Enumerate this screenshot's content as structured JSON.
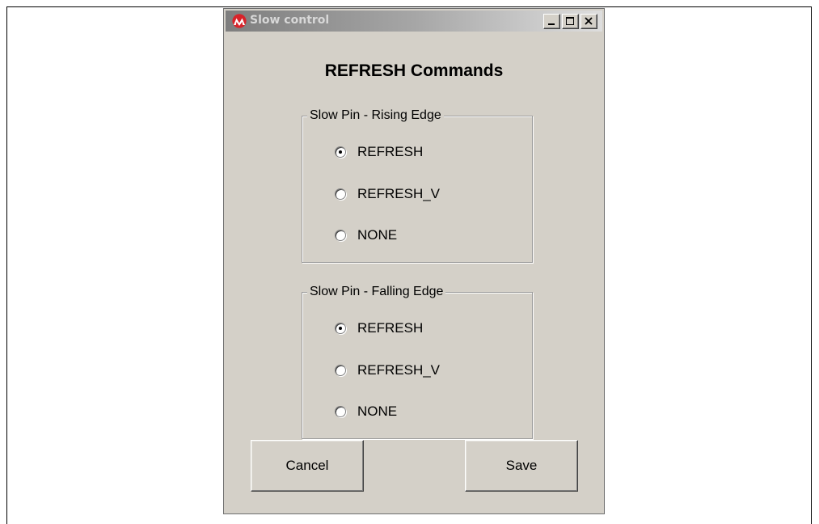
{
  "window": {
    "title": "Slow control",
    "app_icon": "microchip-logo-icon",
    "controls": [
      "minimize-icon",
      "maximize-icon",
      "close-icon"
    ],
    "background_color": "#d4d0c8"
  },
  "heading": "REFRESH Commands",
  "groups": [
    {
      "legend": "Slow Pin - Rising Edge",
      "options": [
        {
          "label": "REFRESH",
          "selected": true
        },
        {
          "label": "REFRESH_V",
          "selected": false
        },
        {
          "label": "NONE",
          "selected": false
        }
      ]
    },
    {
      "legend": "Slow Pin - Falling Edge",
      "options": [
        {
          "label": "REFRESH",
          "selected": true
        },
        {
          "label": "REFRESH_V",
          "selected": false
        },
        {
          "label": "NONE",
          "selected": false
        }
      ]
    }
  ],
  "buttons": {
    "cancel_label": "Cancel",
    "save_label": "Save"
  }
}
